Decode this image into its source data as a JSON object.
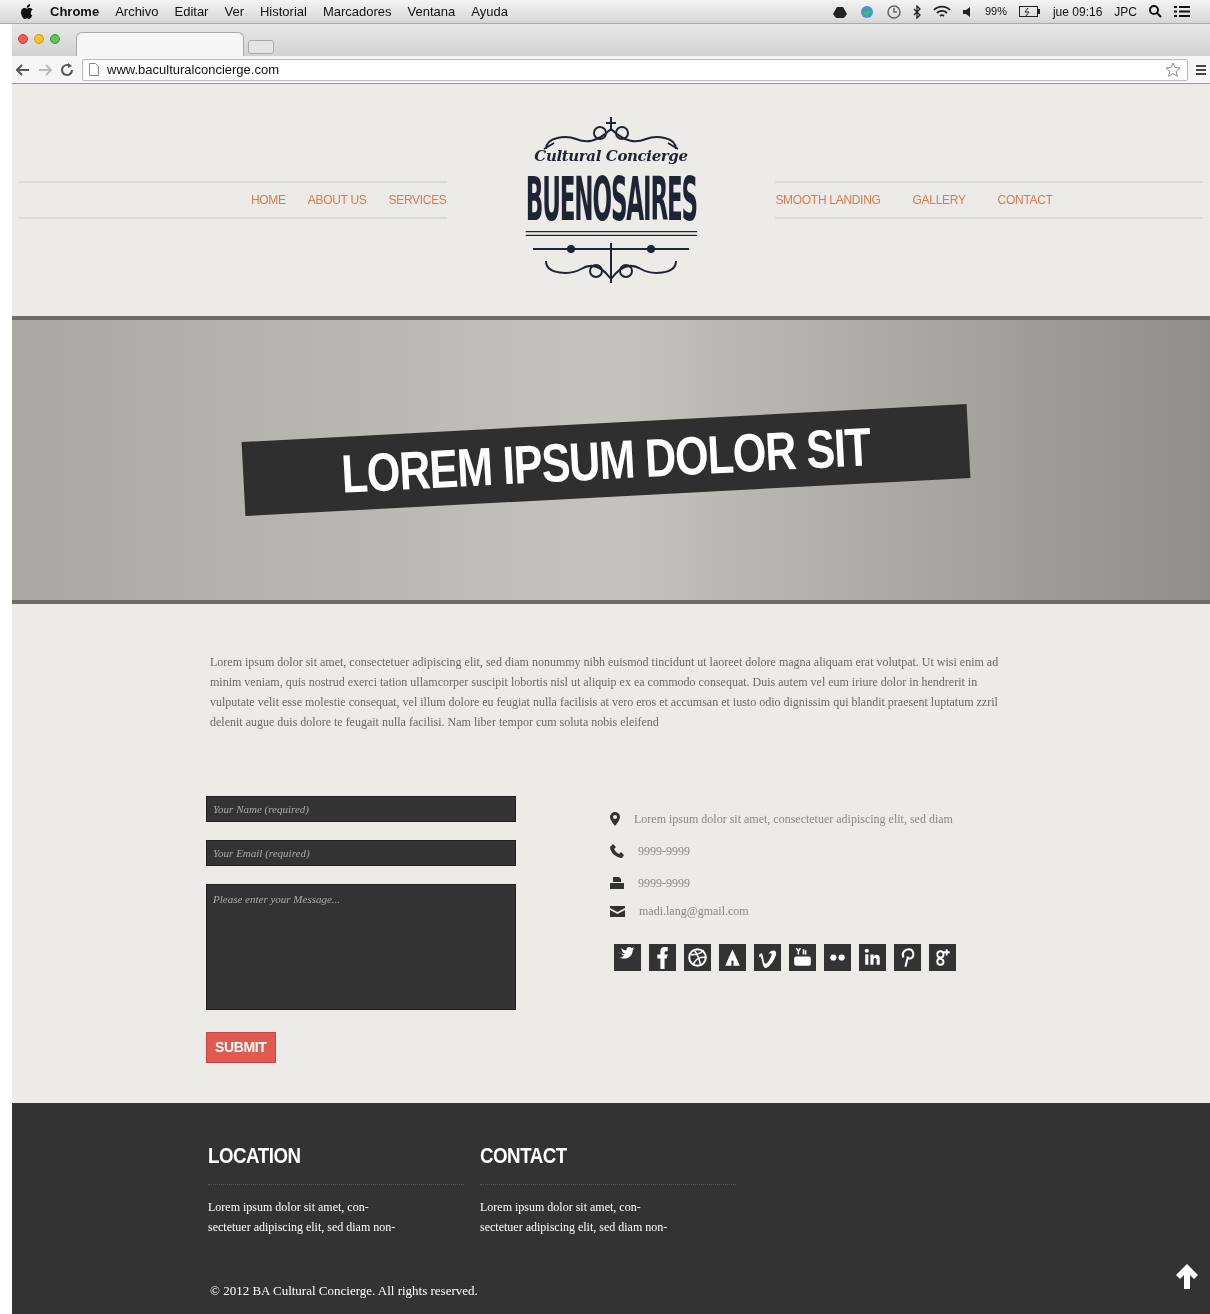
{
  "menubar": {
    "app": "Chrome",
    "menus": [
      "Archivo",
      "Editar",
      "Ver",
      "Historial",
      "Marcadores",
      "Ventana",
      "Ayuda"
    ],
    "battery": "99%",
    "clock": "jue 09:16",
    "user": "JPC"
  },
  "browser": {
    "url": "www.baculturalconcierge.com"
  },
  "logo": {
    "tagline": "Cultural Concierge",
    "name": "BUENOSAIRES"
  },
  "nav_left": [
    "HOME",
    "ABOUT US",
    "SERVICES"
  ],
  "nav_right": [
    "SMOOTH LANDING",
    "GALLERY",
    "CONTACT"
  ],
  "hero": {
    "caption": "LOREM IPSUM DOLOR SIT"
  },
  "intro": "Lorem ipsum dolor sit amet, consectetuer adipiscing elit, sed diam nonummy nibh euismod tincidunt ut laoreet dolore magna aliquam erat volutpat. Ut wisi enim ad minim veniam, quis nostrud exerci tation ullamcorper suscipit lobortis nisl ut aliquip ex ea commodo consequat. Duis autem vel eum iriure dolor in hendrerit in vulputate velit esse molestie consequat, vel illum dolore eu feugiat nulla facilisis at vero eros et accumsan et iusto odio dignissim qui blandit praesent luptatum zzril delenit augue duis dolore te feugait nulla facilisi. Nam liber tempor cum soluta nobis eleifend",
  "form": {
    "name_placeholder": "Your Name (required)",
    "email_placeholder": "Your Email (required)",
    "message_placeholder": "Please enter your Message...",
    "submit": "SUBMIT"
  },
  "contact_info": [
    {
      "kind": "location",
      "text": "Lorem ipsum dolor sit amet, consectetuer adipiscing elit, sed diam"
    },
    {
      "kind": "phone",
      "text": "9999-9999"
    },
    {
      "kind": "fax",
      "text": "9999-9999"
    },
    {
      "kind": "email",
      "text": "madi.lang@gmail.com"
    }
  ],
  "social": [
    {
      "kind": "twitter"
    },
    {
      "kind": "facebook"
    },
    {
      "kind": "dribbble"
    },
    {
      "kind": "forrst"
    },
    {
      "kind": "vimeo"
    },
    {
      "kind": "youtube"
    },
    {
      "kind": "flickr"
    },
    {
      "kind": "linkedin"
    },
    {
      "kind": "pinterest"
    },
    {
      "kind": "googleplus"
    }
  ],
  "footer": {
    "columns": [
      {
        "title": "LOCATION",
        "lines": [
          "Lorem ipsum dolor sit amet, con-",
          "sectetuer adipiscing elit, sed diam non-"
        ]
      },
      {
        "title": "CONTACT",
        "lines": [
          "Lorem ipsum dolor sit amet, con-",
          "sectetuer adipiscing elit, sed diam non-"
        ]
      }
    ],
    "copyright": "© 2012 BA Cultural Concierge. All rights reserved."
  }
}
